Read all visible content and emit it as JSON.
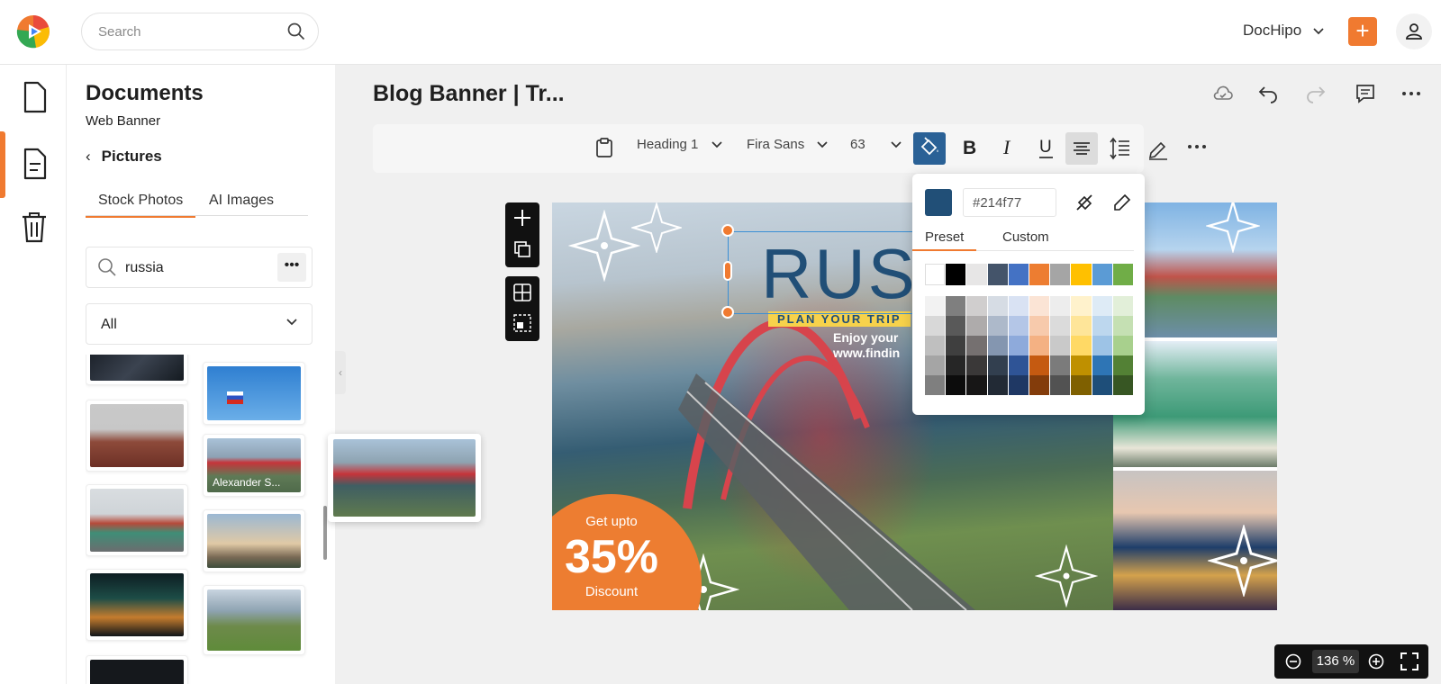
{
  "header": {
    "search_placeholder": "Search",
    "account_name": "DocHipo",
    "accent_color": "#f07a30"
  },
  "rail": {
    "items": [
      {
        "name": "documents",
        "icon": "file-icon"
      },
      {
        "name": "templates",
        "icon": "document-lines-icon"
      },
      {
        "name": "trash",
        "icon": "trash-icon"
      }
    ]
  },
  "panel": {
    "title": "Documents",
    "subtitle": "Web Banner",
    "back_label": "Pictures",
    "tabs": [
      "Stock Photos",
      "AI Images"
    ],
    "active_tab": "Stock Photos",
    "search_value": "russia",
    "filter_value": "All",
    "hover_caption": "Alexander S..."
  },
  "document": {
    "title": "Blog Banner | Tr..."
  },
  "toolbar": {
    "style": "Heading 1",
    "font": "Fira Sans",
    "size": "63"
  },
  "banner": {
    "title": "RUS",
    "tagline": "PLAN YOUR TRIP",
    "line1": "Enjoy your",
    "line2": "www.findin",
    "discount_top": "Get upto",
    "discount_value": "35%",
    "discount_bottom": "Discount",
    "title_color": "#214f77",
    "discount_color": "#ed7d31"
  },
  "color_picker": {
    "hex": "#214f77",
    "tabs": [
      "Preset",
      "Custom"
    ],
    "active_tab": "Preset",
    "top_row": [
      "#ffffff",
      "#000000",
      "#e7e6e6",
      "#44546a",
      "#4472c4",
      "#ed7d31",
      "#a5a5a5",
      "#ffc000",
      "#5b9bd5",
      "#70ad47"
    ],
    "shades": [
      [
        "#f2f2f2",
        "#7f7f7f",
        "#d0cece",
        "#d6dce4",
        "#d9e2f3",
        "#fbe4d5",
        "#ededed",
        "#fff2cc",
        "#deebf6",
        "#e2efd9"
      ],
      [
        "#d8d8d8",
        "#595959",
        "#aeabab",
        "#adb9ca",
        "#b4c6e7",
        "#f7caac",
        "#dbdbdb",
        "#fee599",
        "#bdd7ee",
        "#c5e0b3"
      ],
      [
        "#bfbfbf",
        "#3f3f3f",
        "#757070",
        "#8496b0",
        "#8eaadb",
        "#f4b183",
        "#c9c9c9",
        "#ffd965",
        "#9dc3e6",
        "#a8d08d"
      ],
      [
        "#a5a5a5",
        "#262626",
        "#3a3838",
        "#323f4f",
        "#2f5496",
        "#c55a11",
        "#7b7b7b",
        "#bf9000",
        "#2e75b5",
        "#538135"
      ],
      [
        "#7f7f7f",
        "#0c0c0c",
        "#171616",
        "#222a35",
        "#1f3864",
        "#833c0b",
        "#525252",
        "#7f6000",
        "#1e4e79",
        "#375623"
      ]
    ]
  },
  "zoom": {
    "value": "136 %"
  }
}
